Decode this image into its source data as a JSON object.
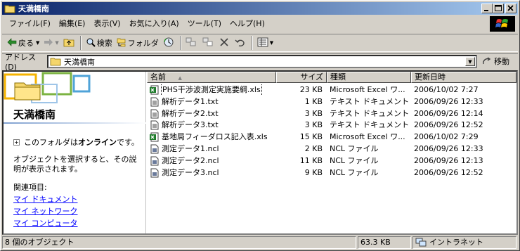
{
  "window": {
    "title": "天満橋南"
  },
  "caption_buttons": {
    "minimize": "_",
    "maximize": "□",
    "close": "×"
  },
  "menu": [
    "ファイル(F)",
    "編集(E)",
    "表示(V)",
    "お気に入り(A)",
    "ツール(T)",
    "ヘルプ(H)"
  ],
  "toolbar": {
    "back": "戻る",
    "search": "検索",
    "folders": "フォルダ"
  },
  "address": {
    "label": "アドレス(D)",
    "value": "天満橋南",
    "go": "移動"
  },
  "leftpane": {
    "title": "天満橋南",
    "online_prefix": "このフォルダは",
    "online_bold": "オンライン",
    "online_suffix": "です。",
    "description": "オブジェクトを選択すると、その説明が表示されます。",
    "related_heading": "関連項目:",
    "links": [
      "マイ ドキュメント",
      "マイ ネットワーク",
      "マイ コンピュータ"
    ]
  },
  "list": {
    "columns": {
      "name": "名前",
      "size": "サイズ",
      "type": "種類",
      "modified": "更新日時"
    },
    "sort_indicator": "▲",
    "files": [
      {
        "name": "PHS干渉波測定実施要綱.xls",
        "size": "23 KB",
        "type": "Microsoft Excel ワ...",
        "modified": "2006/10/02 7:27",
        "icon": "excel"
      },
      {
        "name": "解析データ1.txt",
        "size": "1 KB",
        "type": "テキスト ドキュメント",
        "modified": "2006/09/26 12:33",
        "icon": "text"
      },
      {
        "name": "解析データ2.txt",
        "size": "3 KB",
        "type": "テキスト ドキュメント",
        "modified": "2006/09/26 12:14",
        "icon": "text"
      },
      {
        "name": "解析データ3.txt",
        "size": "3 KB",
        "type": "テキスト ドキュメント",
        "modified": "2006/09/26 12:52",
        "icon": "text"
      },
      {
        "name": "基地局フィーダロス記入表.xls",
        "size": "15 KB",
        "type": "Microsoft Excel ワ...",
        "modified": "2006/10/02 7:29",
        "icon": "excel"
      },
      {
        "name": "測定データ1.ncl",
        "size": "2 KB",
        "type": "NCL ファイル",
        "modified": "2006/09/26 12:33",
        "icon": "ncl"
      },
      {
        "name": "測定データ2.ncl",
        "size": "11 KB",
        "type": "NCL ファイル",
        "modified": "2006/09/26 12:13",
        "icon": "ncl"
      },
      {
        "name": "測定データ3.ncl",
        "size": "9 KB",
        "type": "NCL ファイル",
        "modified": "2006/09/26 12:52",
        "icon": "ncl"
      }
    ]
  },
  "status": {
    "objects": "8 個のオブジェクト",
    "size": "63.3 KB",
    "zone": "イントラネット"
  },
  "colors": {
    "title_start": "#0a246a",
    "title_end": "#a6caf0",
    "link": "#0000ff",
    "excel_green": "#1e7a2a"
  }
}
